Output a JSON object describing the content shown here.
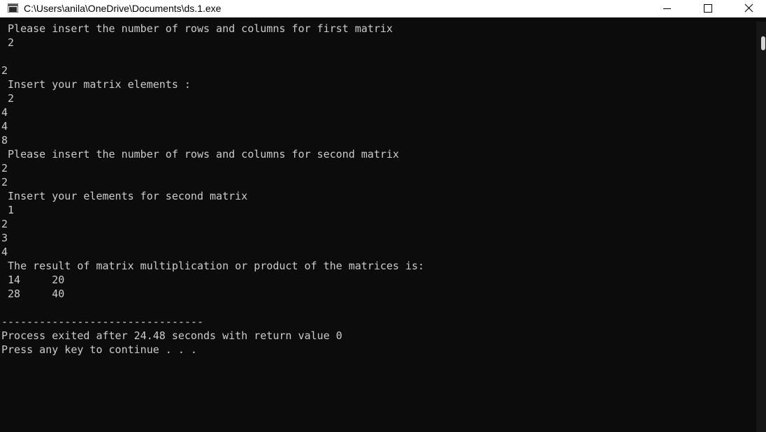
{
  "window": {
    "title": "C:\\Users\\anila\\OneDrive\\Documents\\ds.1.exe",
    "icon": "console-app-icon",
    "controls": [
      "minimize-icon",
      "maximize-icon",
      "close-icon"
    ]
  },
  "console": {
    "lines": [
      " Please insert the number of rows and columns for first matrix",
      " 2",
      "",
      "2",
      " Insert your matrix elements :",
      " 2",
      "4",
      "4",
      "8",
      " Please insert the number of rows and columns for second matrix",
      "2",
      "2",
      " Insert your elements for second matrix",
      " 1",
      "2",
      "3",
      "4",
      " The result of matrix multiplication or product of the matrices is:",
      " 14     20",
      " 28     40",
      "",
      "--------------------------------",
      "Process exited after 24.48 seconds with return value 0",
      "Press any key to continue . . ."
    ]
  }
}
